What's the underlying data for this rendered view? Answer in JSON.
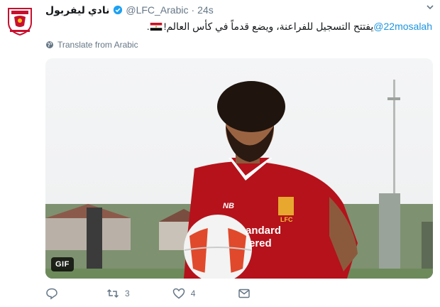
{
  "tweet": {
    "display_name": "نادي ليفربول",
    "handle": "@LFC_Arabic",
    "separator": "·",
    "time": "24s",
    "text_before": "يفتتح التسجيل للفراعنة، ويضع قدماً في كأس العالم!",
    "mention": "@22mosalah",
    "text_end": ".",
    "translate_label": "Translate from Arabic"
  },
  "media": {
    "badge": "GIF",
    "shirt_text_1": "andard",
    "shirt_text_2": "ered",
    "crest_text": "LFC",
    "shirt_brand": "NB"
  },
  "actions": {
    "reply_count": "",
    "retweet_count": "3",
    "like_count": "4"
  },
  "colors": {
    "link": "#1b95e0",
    "muted": "#657786",
    "jersey": "#b5121b",
    "verified": "#1da1f2"
  },
  "icons": [
    "lfc-crest-icon",
    "verified-icon",
    "chevron-down-icon",
    "globe-icon",
    "egypt-flag-icon",
    "reply-icon",
    "retweet-icon",
    "like-icon",
    "message-icon"
  ]
}
